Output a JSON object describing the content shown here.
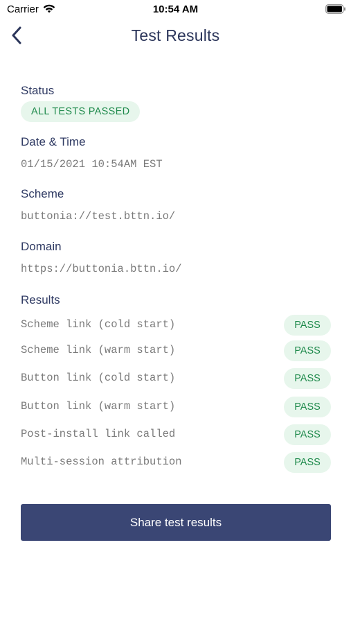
{
  "status_bar": {
    "carrier": "Carrier",
    "time": "10:54 AM"
  },
  "nav": {
    "title": "Test Results"
  },
  "status": {
    "label": "Status",
    "badge": "ALL TESTS PASSED"
  },
  "datetime": {
    "label": "Date & Time",
    "value": "01/15/2021 10:54AM EST"
  },
  "scheme": {
    "label": "Scheme",
    "value": "buttonia://test.bttn.io/"
  },
  "domain": {
    "label": "Domain",
    "value": "https://buttonia.bttn.io/"
  },
  "results": {
    "label": "Results",
    "items": [
      {
        "name": "Scheme link (cold start)",
        "result": "PASS"
      },
      {
        "name": "Scheme link (warm start)",
        "result": "PASS"
      },
      {
        "name": "Button link (cold start)",
        "result": "PASS"
      },
      {
        "name": "Button link (warm start)",
        "result": "PASS"
      },
      {
        "name": "Post-install link called",
        "result": "PASS"
      },
      {
        "name": "Multi-session attribution",
        "result": "PASS"
      }
    ]
  },
  "share_button": "Share test results",
  "colors": {
    "primary": "#3a4674",
    "heading": "#2b355a",
    "success_bg": "#e7f6ec",
    "success_text": "#1f8a4c",
    "mono_text": "#7a7a7a"
  },
  "icons": {
    "back": "chevron-left-icon",
    "wifi": "wifi-icon",
    "battery": "battery-icon"
  }
}
